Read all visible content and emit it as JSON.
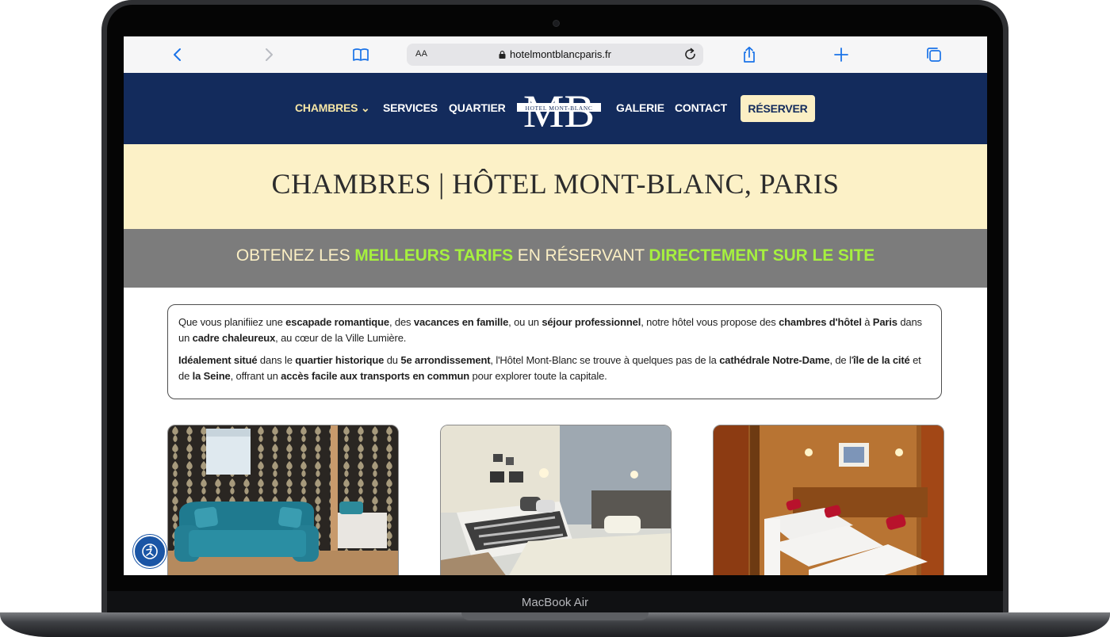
{
  "device": {
    "label": "MacBook Air"
  },
  "browser": {
    "text_size_label": "AA",
    "url": "hotelmontblancparis.fr",
    "icons": [
      "back-icon",
      "forward-icon",
      "bookmarks-icon",
      "lock-icon",
      "reload-icon",
      "share-icon",
      "new-tab-icon",
      "tabs-icon"
    ]
  },
  "nav": {
    "items": [
      {
        "label": "CHAMBRES ⌄",
        "active": true
      },
      {
        "label": "SERVICES"
      },
      {
        "label": "QUARTIER"
      },
      {
        "label": "GALERIE"
      },
      {
        "label": "CONTACT"
      }
    ],
    "logo": {
      "monogram": "MB",
      "text": "HOTEL MONT-BLANC"
    },
    "reserve_label": "RÉSERVER"
  },
  "page": {
    "title": "CHAMBRES | HÔTEL MONT-BLANC, PARIS",
    "promo": {
      "part1": "OBTENEZ LES ",
      "highlight1": "MEILLEURS TARIFS",
      "part2": " EN RÉSERVANT ",
      "highlight2": "DIRECTEMENT SUR LE SITE"
    },
    "intro": {
      "p1": [
        {
          "t": "Que vous planifiiez une "
        },
        {
          "t": "escapade romantique",
          "b": true
        },
        {
          "t": ", des "
        },
        {
          "t": "vacances en famille",
          "b": true
        },
        {
          "t": ", ou un "
        },
        {
          "t": "séjour professionnel",
          "b": true
        },
        {
          "t": ", notre hôtel vous propose des "
        },
        {
          "t": "chambres d'hôtel",
          "b": true
        },
        {
          "t": " à "
        },
        {
          "t": "Paris",
          "b": true
        },
        {
          "t": " dans un "
        },
        {
          "t": "cadre chaleureux",
          "b": true
        },
        {
          "t": ", au cœur de la Ville Lumière."
        }
      ],
      "p2": [
        {
          "t": "Idéalement situé",
          "b": true
        },
        {
          "t": " dans le "
        },
        {
          "t": "quartier historique",
          "b": true
        },
        {
          "t": " du "
        },
        {
          "t": "5e arrondissement",
          "b": true
        },
        {
          "t": ",  l'Hôtel Mont-Blanc se trouve à quelques pas de la "
        },
        {
          "t": "cathédrale Notre-Dame",
          "b": true
        },
        {
          "t": ", de l'"
        },
        {
          "t": "île de la cité",
          "b": true
        },
        {
          "t": " et de "
        },
        {
          "t": "la Seine",
          "b": true
        },
        {
          "t": ", offrant un "
        },
        {
          "t": "accès facile aux transports en commun",
          "b": true
        },
        {
          "t": " pour explorer toute la capitale."
        }
      ]
    },
    "rooms": [
      "room-photo-blue-damask",
      "room-photo-grey-twin",
      "room-photo-wood-triple"
    ],
    "accessibility_icon": "accessibility-icon"
  },
  "colors": {
    "nav_bg": "#132b5c",
    "title_band": "#fcf1c7",
    "promo_band": "#7c7c7c",
    "promo_highlight": "#a6f03f",
    "reserve_button": "#fbefc4",
    "link_blue": "#1a73e8"
  }
}
